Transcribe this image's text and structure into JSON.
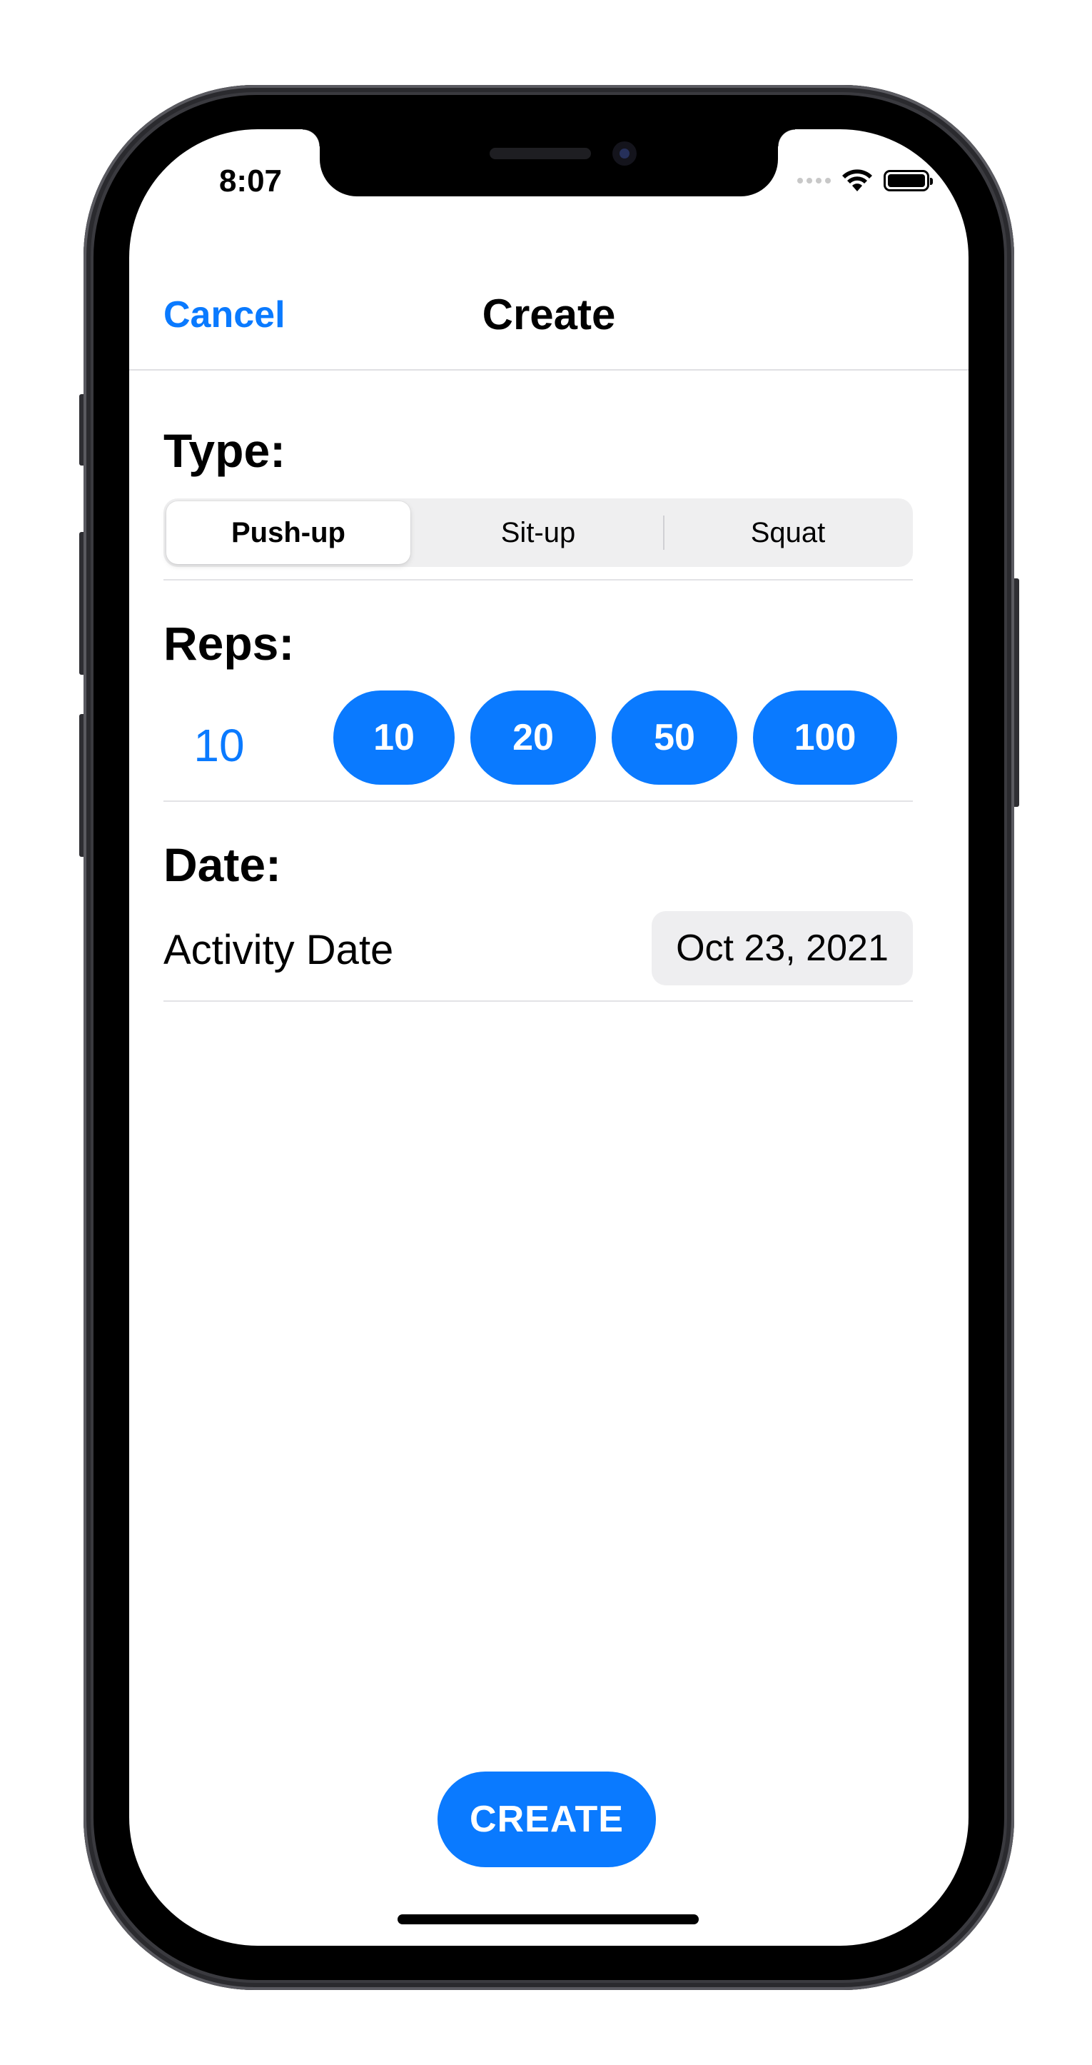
{
  "status_bar": {
    "time": "8:07",
    "icons": [
      "cellular-dots-icon",
      "wifi-icon",
      "battery-icon"
    ]
  },
  "nav": {
    "cancel_label": "Cancel",
    "title": "Create"
  },
  "type_section": {
    "label": "Type:",
    "options": [
      "Push-up",
      "Sit-up",
      "Squat"
    ],
    "selected": "Push-up"
  },
  "reps_section": {
    "label": "Reps:",
    "current_value": "10",
    "presets": [
      "10",
      "20",
      "50",
      "100"
    ]
  },
  "date_section": {
    "label": "Date:",
    "field_label": "Activity Date",
    "value": "Oct 23, 2021"
  },
  "create_button_label": "CREATE",
  "colors": {
    "accent": "#0a7aff",
    "segment_bg": "#efeff0",
    "divider": "#e3e3e6"
  }
}
